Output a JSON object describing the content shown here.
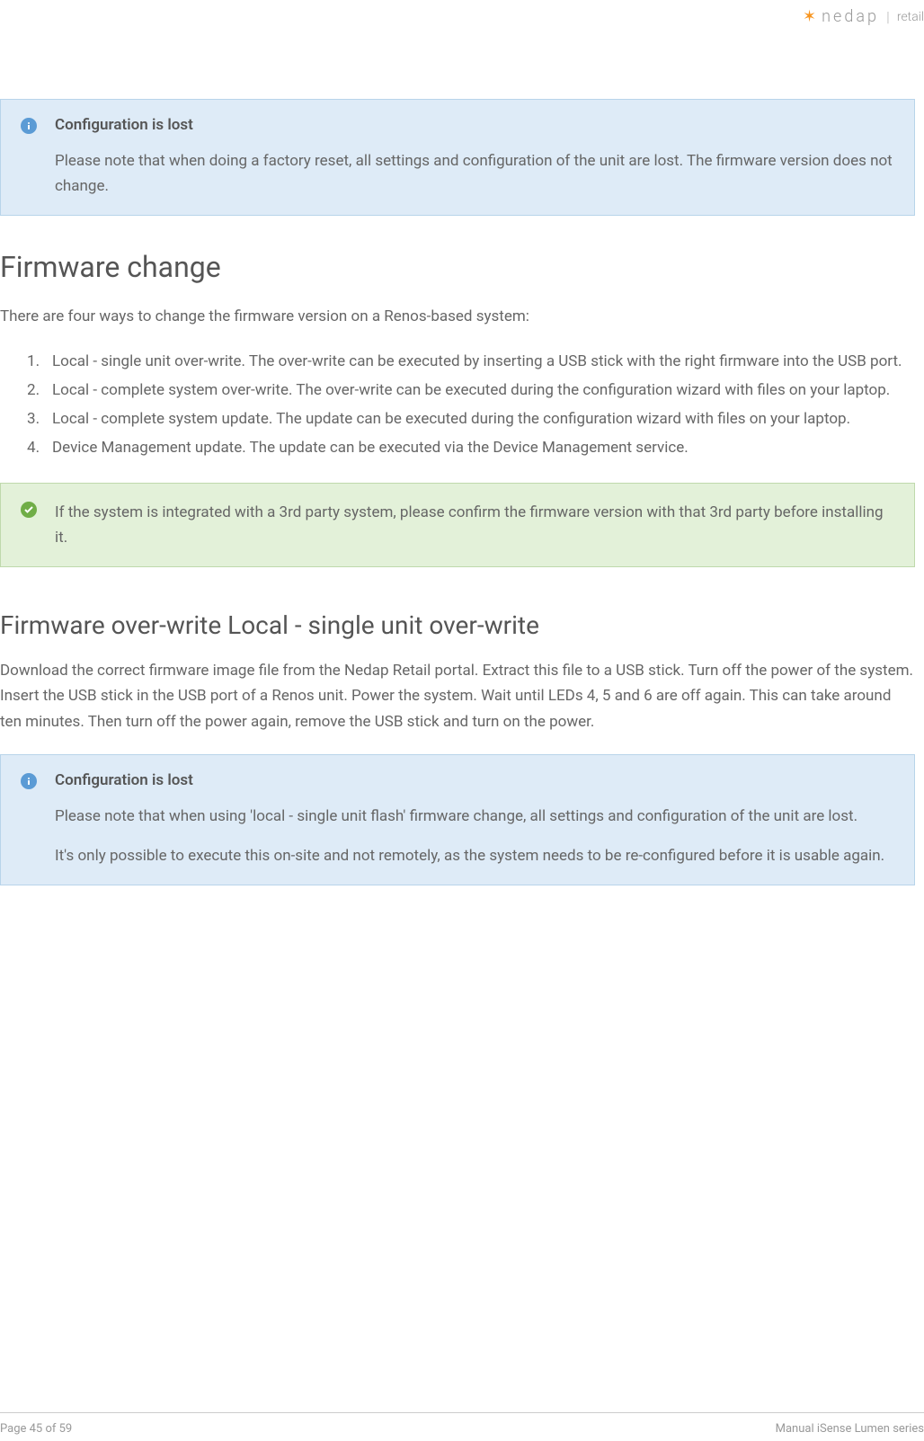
{
  "header": {
    "logo_brand": "nedap",
    "logo_suffix": "retail"
  },
  "callout1": {
    "title": "Configuration is lost",
    "body": "Please note that when doing a factory reset, all settings and configuration of the unit are lost. The firmware version does not change."
  },
  "section1": {
    "heading": "Firmware change",
    "intro": "There are four ways to change the firmware version on a Renos-based system:",
    "items": [
      "Local - single unit over-write. The over-write can be executed by inserting a USB stick with the right firmware into the USB port.",
      "Local - complete system over-write. The over-write can be executed during the configuration wizard with files on your laptop.",
      "Local - complete system update. The update can be executed during the configuration wizard with files on your laptop.",
      "Device Management update. The update can be executed via the Device Management service."
    ]
  },
  "callout2": {
    "body": "If the system is integrated with a 3rd party system, please confirm the firmware version with that 3rd party before installing it."
  },
  "section2": {
    "heading": "Firmware over-write Local - single unit over-write",
    "body": "Download the correct firmware image file from the Nedap Retail portal. Extract this file to a USB stick. Turn off the power of the system. Insert the USB stick in the USB port of a Renos unit. Power the system. Wait until LEDs 4, 5 and 6 are off again. This can take around ten minutes. Then turn off the power again, remove the USB stick and turn on the power."
  },
  "callout3": {
    "title": "Configuration is lost",
    "body1": "Please note that when using 'local - single unit flash' firmware change, all settings and configuration of the unit are lost.",
    "body2": "It's only possible to execute this on-site and not remotely, as the system needs to be re-configured before it is usable again."
  },
  "footer": {
    "page": "Page 45 of 59",
    "title": "Manual iSense Lumen series"
  }
}
